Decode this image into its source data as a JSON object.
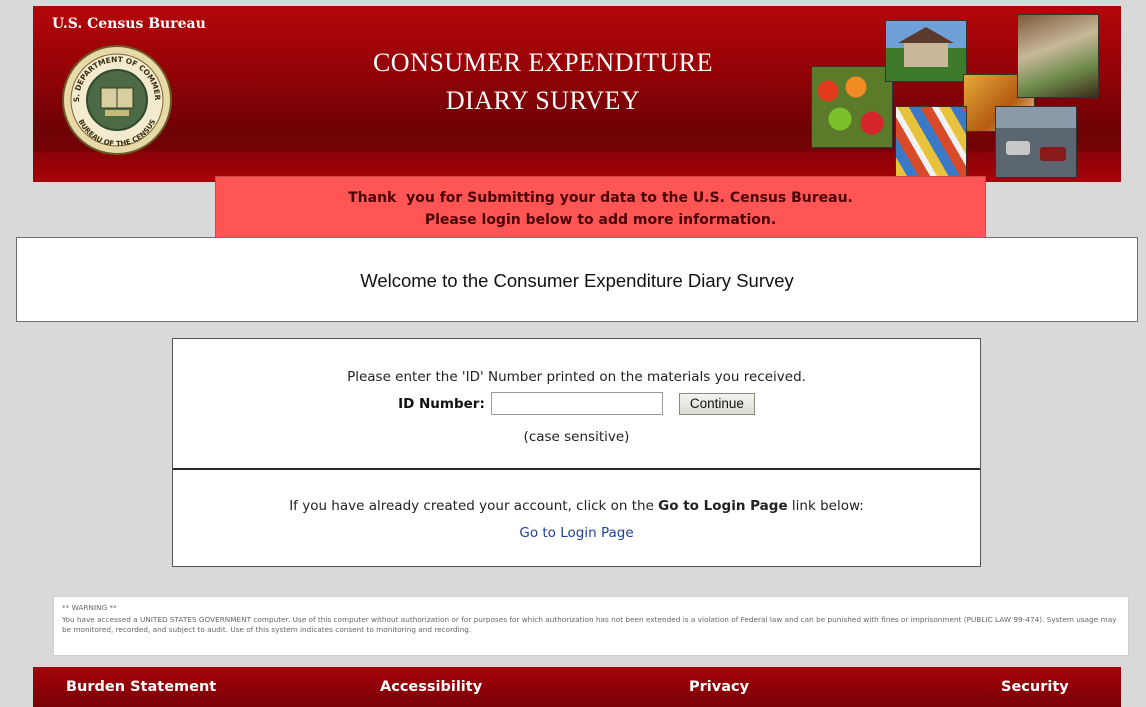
{
  "header": {
    "agency_name": "U.S. Census Bureau",
    "seal_top_text": "U.S. DEPARTMENT OF COMMERCE",
    "seal_bottom_text": "BUREAU OF THE CENSUS",
    "survey_title_line1": "CONSUMER EXPENDITURE",
    "survey_title_line2": "DIARY SURVEY"
  },
  "banner": {
    "line1": "Thank  you for Submitting your data to the U.S. Census Bureau.",
    "line2": "Please login below to add more information."
  },
  "welcome": {
    "text": "Welcome to the Consumer Expenditure Diary Survey"
  },
  "login": {
    "instruction": "Please enter the 'ID' Number printed on the materials you received.",
    "id_label": "ID Number:",
    "id_value": "",
    "continue_label": "Continue",
    "case_note": "(case sensitive)",
    "already_prefix": "If you have already created your account, click on the ",
    "already_bold": "Go to Login Page",
    "already_suffix": " link below:",
    "go_login_link": "Go to Login Page"
  },
  "warning": {
    "heading": "** WARNING **",
    "body": "You have accessed a UNITED STATES GOVERNMENT computer. Use of this computer without authorization or for purposes for which authorization has not been extended is a violation of Federal law and can be punished with fines or imprisonment (PUBLIC LAW 99-474). System usage may be monitored, recorded, and subject to audit. Use of this system indicates consent to monitoring and recording."
  },
  "footer": {
    "links": [
      "Burden Statement",
      "Accessibility",
      "Privacy",
      "Security"
    ]
  },
  "colors": {
    "header_red": "#960307",
    "banner_red": "#ff5555",
    "link_blue": "#1f3fa0",
    "page_gray": "#d9d9d9"
  },
  "icons": {
    "seal": "census-seal-icon"
  }
}
